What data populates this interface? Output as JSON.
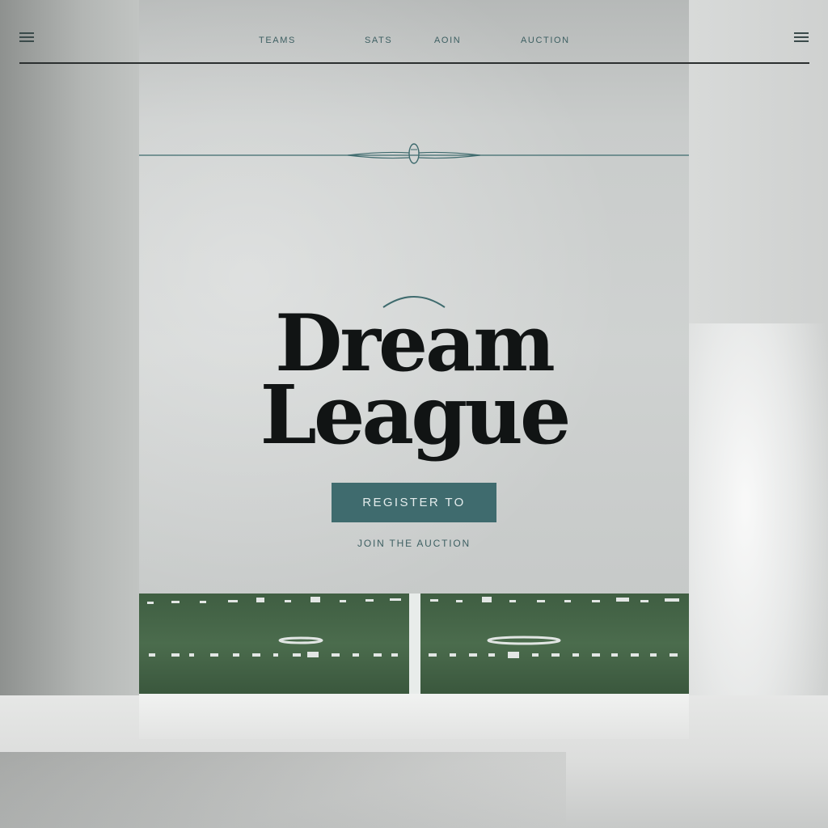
{
  "header": {
    "nav": [
      {
        "label": "TEAMS"
      },
      {
        "label": "SATS"
      },
      {
        "label": "AOIN"
      },
      {
        "label": "AUCTION"
      }
    ],
    "menu_left_icon": "menu-icon",
    "menu_right_icon": "menu-icon"
  },
  "hero": {
    "title_line1": "Dream",
    "title_line2": "League",
    "cta_label": "REGISTER TO",
    "sub_label": "JOIN THE AUCTION"
  },
  "colors": {
    "accent": "#3f6b6e",
    "nav_text": "#3d5f62",
    "title_text": "#111414",
    "field_green": "#4a6b4b"
  }
}
